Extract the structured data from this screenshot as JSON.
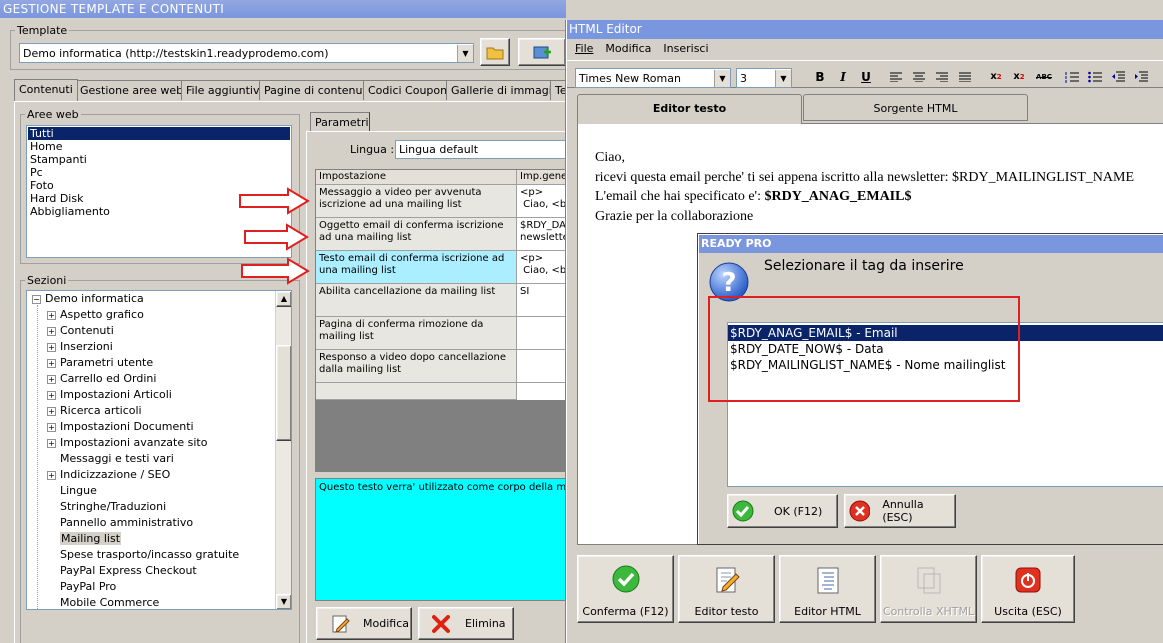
{
  "main": {
    "title": "GESTIONE TEMPLATE E CONTENUTI",
    "template_label": "Template",
    "template_value": "Demo informatica (http://testskin1.readyprodemo.com)",
    "tabs": [
      "Contenuti",
      "Gestione aree web",
      "File aggiuntivi",
      "Pagine di contenuti",
      "Codici Coupon",
      "Gallerie di immagini",
      "Te"
    ],
    "aree_web_label": "Aree web",
    "aree_web_items": [
      "Tutti",
      "Home",
      "Stampanti",
      "Pc",
      "Foto",
      "Hard Disk",
      "Abbigliamento"
    ],
    "sezioni_label": "Sezioni",
    "tree_root": "Demo informatica",
    "tree_items": [
      {
        "label": "Aspetto grafico",
        "exp": true
      },
      {
        "label": "Contenuti",
        "exp": true
      },
      {
        "label": "Inserzioni",
        "exp": true
      },
      {
        "label": "Parametri utente",
        "exp": true
      },
      {
        "label": "Carrello ed Ordini",
        "exp": true
      },
      {
        "label": "Impostazioni Articoli",
        "exp": true
      },
      {
        "label": "Ricerca articoli",
        "exp": true
      },
      {
        "label": "Impostazioni Documenti",
        "exp": true
      },
      {
        "label": "Impostazioni avanzate sito",
        "exp": true
      },
      {
        "label": "Messaggi e testi vari",
        "exp": false
      },
      {
        "label": "Indicizzazione / SEO",
        "exp": true
      },
      {
        "label": "Lingue",
        "exp": false
      },
      {
        "label": "Stringhe/Traduzioni",
        "exp": false
      },
      {
        "label": "Pannello amministrativo",
        "exp": false
      },
      {
        "label": "Mailing list",
        "exp": false
      },
      {
        "label": "Spese trasporto/incasso gratuite",
        "exp": false
      },
      {
        "label": "PayPal Express Checkout",
        "exp": false
      },
      {
        "label": "PayPal Pro",
        "exp": false
      },
      {
        "label": "Mobile Commerce",
        "exp": false
      }
    ],
    "parametri_tab": "Parametri",
    "lingua_label": "Lingua :",
    "lingua_value": "Lingua default",
    "grid_headers": [
      "Impostazione",
      "Imp.gene"
    ],
    "grid_rows": [
      {
        "name": "Messaggio a video per avvenuta iscrizione ad una mailing list",
        "value": "<p>\n Ciao, <br"
      },
      {
        "name": "Oggetto email di conferma iscrizione ad una mailing list",
        "value": "$RDY_DA\nnewslette"
      },
      {
        "name": "Testo email di conferma iscrizione ad una mailing list",
        "value": "<p>\n Ciao, <br"
      },
      {
        "name": "Abilita cancellazione da mailing list",
        "value": "SI"
      },
      {
        "name": "Pagina di conferma rimozione da mailing list",
        "value": ""
      },
      {
        "name": "Responso a video dopo cancellazione dalla mailing list",
        "value": ""
      }
    ],
    "description": "Questo testo verra' utilizzato come corpo della mail d",
    "modifica": "Modifica",
    "elimina": "Elimina"
  },
  "editor": {
    "title": "HTML Editor",
    "menu": [
      "File",
      "Modifica",
      "Inserisci"
    ],
    "font": "Times New Roman",
    "size": "3",
    "toolbar": {
      "bold": "B",
      "italic": "I",
      "underline": "U",
      "abc": "ABC"
    },
    "tabs": [
      "Editor testo",
      "Sorgente HTML"
    ],
    "content": {
      "l1": "Ciao,",
      "l2": "ricevi questa email perche' ti sei appena iscritto alla newsletter: $RDY_MAILINGLIST_NAME",
      "l3a": "L'email che hai specificato e': ",
      "l3b": "$RDY_ANAG_EMAIL$",
      "l4": "Grazie per la collaborazione"
    },
    "buttons": [
      "Conferma (F12)",
      "Editor testo",
      "Editor HTML",
      "Controlla XHTML",
      "Uscita (ESC)"
    ]
  },
  "dialog": {
    "title": "READY PRO",
    "prompt": "Selezionare il tag da inserire",
    "items": [
      "$RDY_ANAG_EMAIL$ - Email",
      "$RDY_DATE_NOW$ - Data",
      "$RDY_MAILINGLIST_NAME$ - Nome mailinglist"
    ],
    "ok": "OK (F12)",
    "cancel": "Annulla (ESC)"
  },
  "colors": {
    "titlebar": "#7a96df",
    "selection": "#0a246a",
    "highlight_row": "#aaeeff",
    "description_bg": "#00ffff",
    "annotation": "#e02020"
  }
}
